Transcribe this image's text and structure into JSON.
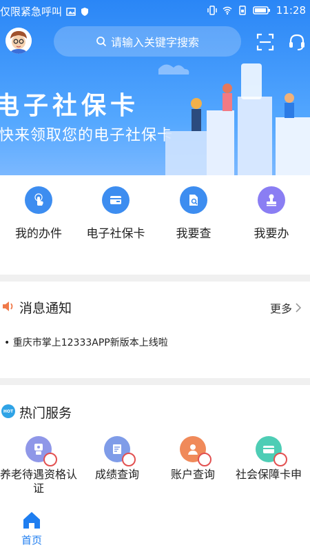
{
  "status_bar": {
    "carrier_text": "仅限紧急呼叫",
    "time": "11:28"
  },
  "header": {
    "search_placeholder": "请输入关键字搜索",
    "icons": [
      "avatar",
      "search-icon",
      "scan-icon",
      "headset-icon"
    ]
  },
  "banner": {
    "title": "电子社保卡",
    "subtitle": "快来领取您的电子社保卡"
  },
  "quick_actions": [
    {
      "label": "我的办件",
      "icon": "hand-tap-icon",
      "color": "#3d8df0"
    },
    {
      "label": "电子社保卡",
      "icon": "card-icon",
      "color": "#3d8df0"
    },
    {
      "label": "我要查",
      "icon": "document-search-icon",
      "color": "#3d8df0"
    },
    {
      "label": "我要办",
      "icon": "stamp-icon",
      "color": "#8a7ef3"
    }
  ],
  "notice": {
    "title": "消息通知",
    "more_label": "更多",
    "items": [
      "重庆市掌上12333APP新版本上线啦"
    ]
  },
  "hot_services": {
    "badge_text": "HOT",
    "title": "热门服务",
    "items": [
      {
        "label": "养老待遇资格认证",
        "icon": "face-verify-icon",
        "color": "#8f97e8"
      },
      {
        "label": "成绩查询",
        "icon": "grades-icon",
        "color": "#7f9ce8"
      },
      {
        "label": "账户查询",
        "icon": "account-icon",
        "color": "#f08a5a"
      },
      {
        "label": "社会保障卡申",
        "icon": "social-card-icon",
        "color": "#4ecdb5"
      }
    ]
  },
  "tabbar": {
    "home_label": "首页"
  },
  "colors": {
    "primary": "#1f7ef0",
    "banner_top": "#2a86f6",
    "divider": "#f0f0f0"
  }
}
